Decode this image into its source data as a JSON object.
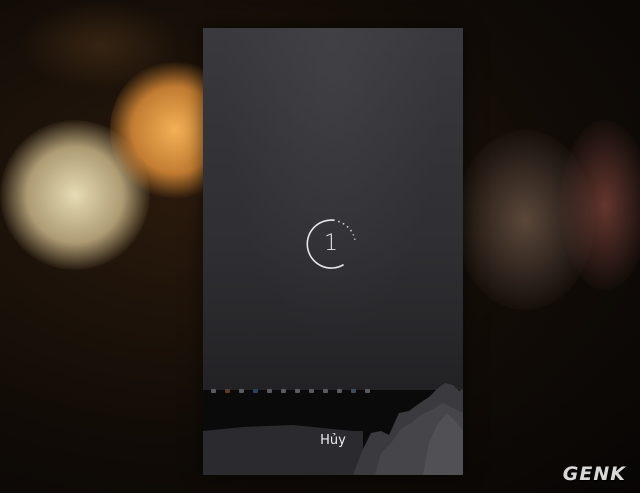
{
  "screen": {
    "countdown_value": "1",
    "cancel_label": "Hủy"
  },
  "brand": {
    "watermark": "GENK"
  },
  "colors": {
    "accent_text": "#e8e8ea",
    "phone_background": "#0a0a0b"
  }
}
